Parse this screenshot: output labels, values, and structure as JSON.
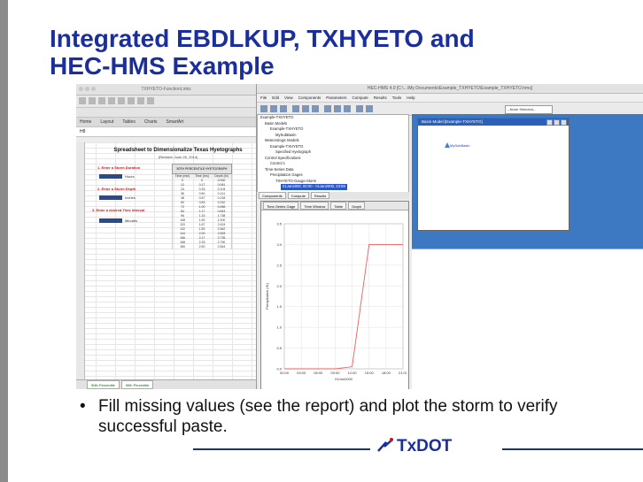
{
  "slide": {
    "title_line1": "Integrated EBDLKUP, TXHYETO and",
    "title_line2": "HEC-HMS Example",
    "bullet": "Fill missing values (see the report) and plot the storm to verify successful paste.",
    "logo_text": "TxDOT",
    "colors": {
      "title": "#1a2e9c",
      "left_bar": "#8c8c8c",
      "accent_blue": "#3d79c2"
    }
  },
  "excel": {
    "window_title": "TXHYETO-FunctionLinks",
    "ribbon_tabs": [
      "Home",
      "Layout",
      "Tables",
      "Charts",
      "SmartArt"
    ],
    "cell_ref": "H8",
    "sheet_heading": "Spreadsheet to Dimensionalize Texas Hyetographs",
    "sheet_sub": "(Revised: June 26, 2014)",
    "step1": "1. Enter a Storm Duration",
    "step1_unit": "Hours",
    "step2": "2. Enter a Storm Depth",
    "step2_unit": "Inches",
    "step3": "3. Enter a desired Time Interval",
    "step3_unit": "Minutes",
    "table_header": "50TH PERCENTILE HYETOGRAPH",
    "table_cols": [
      "Time (min)",
      "Time (hrs)",
      "Depth (in)"
    ],
    "table_rows": [
      [
        "0",
        "0",
        "0.000"
      ],
      [
        "12",
        "0.17",
        "0.061"
      ],
      [
        "24",
        "0.33",
        "0.104"
      ],
      [
        "36",
        "0.50",
        "0.141"
      ],
      [
        "48",
        "0.67",
        "0.218"
      ],
      [
        "60",
        "0.83",
        "0.310"
      ],
      [
        "72",
        "1.00",
        "0.456"
      ],
      [
        "84",
        "1.17",
        "0.843"
      ],
      [
        "96",
        "1.33",
        "1.738"
      ],
      [
        "108",
        "1.50",
        "2.200"
      ],
      [
        "120",
        "1.67",
        "2.424"
      ],
      [
        "132",
        "1.83",
        "2.562"
      ],
      [
        "144",
        "2.00",
        "2.653"
      ],
      [
        "156",
        "2.17",
        "2.735"
      ],
      [
        "168",
        "2.33",
        "2.790"
      ],
      [
        "180",
        "2.50",
        "2.844"
      ]
    ],
    "sheet_tabs": [
      "50th Percentile",
      "90th Percentile"
    ]
  },
  "hms": {
    "window_title": "HEC-HMS 4.0 [C:\\...\\My Documents\\Example_TXHYETO\\Example_TXHYETO.hms]",
    "menu": [
      "File",
      "Edit",
      "View",
      "Components",
      "Parameters",
      "Compute",
      "Results",
      "Tools",
      "Help"
    ],
    "selector": "--None Selected--",
    "tree": [
      "Example-TXHYETO",
      "Basin Models",
      "Example-TXHYETO",
      "MySubBasin",
      "Meteorologic Models",
      "Example-TXHYETO",
      "Specified Hyetograph",
      "Control Specifications",
      "Control 1",
      "Time-Series Data",
      "Precipitation Gages",
      "TXHYETO-Gauge-Storm",
      "01Jan2000, 00:00 - 01Jan2000, 23:59"
    ],
    "tree_tabs": [
      "Components",
      "Compute",
      "Results"
    ],
    "ts_tabs": [
      "Time-Series Gage",
      "Time Window",
      "Table",
      "Graph"
    ],
    "ts_window_title": "Time-Series Gage",
    "basin_title": "Basin Model [Example-TXHYETO]",
    "subbasin_label": "MySubBasin"
  },
  "chart_data": {
    "type": "line",
    "title": "",
    "xlabel": "01Jan2000",
    "ylabel": "Precipitation (IN)",
    "x": [
      "00:00",
      "03:00",
      "06:00",
      "09:00",
      "12:00",
      "15:00",
      "18:00",
      "21:00"
    ],
    "series": [
      {
        "values": [
          0,
          0,
          0,
          0,
          0.05,
          3.0,
          3.0,
          3.0
        ],
        "color": "#e86060"
      }
    ],
    "ylim": [
      0,
      3.5
    ],
    "yticks": [
      "0.0",
      "0.5",
      "1.0",
      "1.5",
      "2.0",
      "2.5",
      "3.0",
      "3.5"
    ],
    "grid": true
  }
}
